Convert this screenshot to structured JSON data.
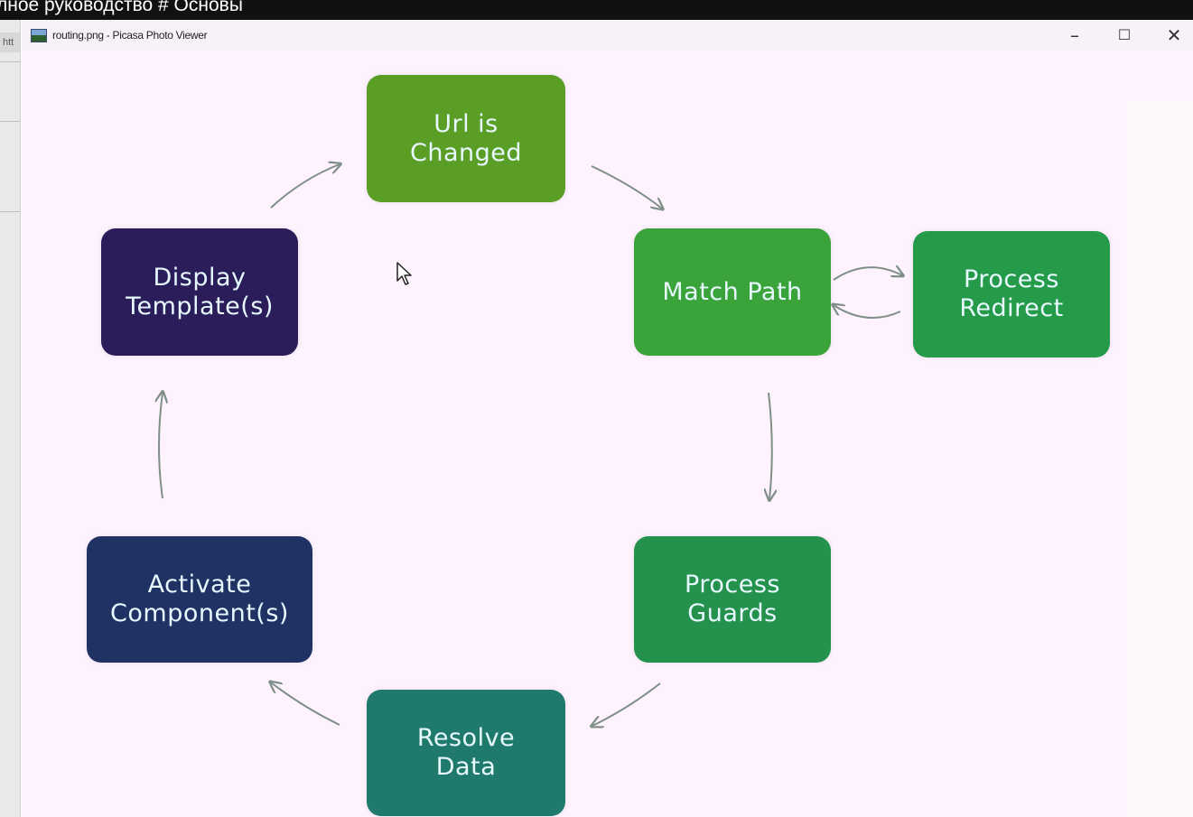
{
  "video": {
    "title": "лное руководство # Основы"
  },
  "left_strip": {
    "tab_text": "htt"
  },
  "viewer": {
    "window_title": "routing.png - Picasa Photo Viewer",
    "minimize_symbol": "–",
    "maximize_symbol": "☐",
    "close_symbol": "✕"
  },
  "diagram": {
    "url_changed": "Url is\nChanged",
    "match_path": "Match Path",
    "process_redirect": "Process\nRedirect",
    "process_guards": "Process\nGuards",
    "resolve_data": "Resolve\nData",
    "activate_components": "Activate\nComponent(s)",
    "display_templates": "Display\nTemplate(s)"
  },
  "colors": {
    "url_changed": "#5a9e26",
    "match_path": "#3aa33a",
    "process_redirect": "#259b4a",
    "process_guards": "#24924c",
    "resolve_data": "#1f7a6b",
    "activate_components": "#203263",
    "display_templates": "#2a1d5a",
    "arrow": "#7f8f88"
  },
  "icons": {
    "app": "picasa-app-icon",
    "cursor": "mouse-pointer-icon"
  }
}
